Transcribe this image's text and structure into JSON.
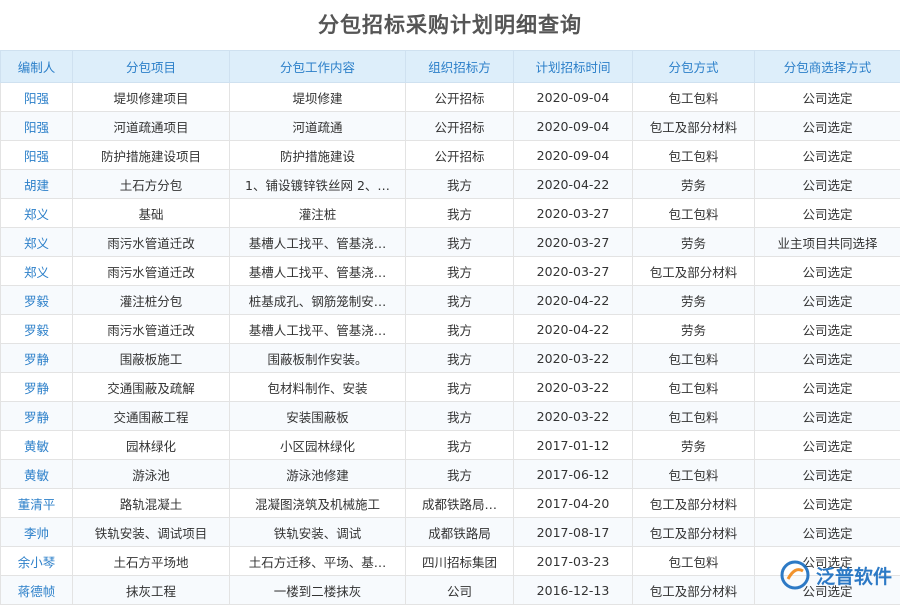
{
  "page": {
    "title": "分包招标采购计划明细查询"
  },
  "table": {
    "columns": [
      "编制人",
      "分包项目",
      "分包工作内容",
      "组织招标方",
      "计划招标时间",
      "分包方式",
      "分包商选择方式"
    ],
    "rows": [
      [
        "阳强",
        "堤坝修建项目",
        "堤坝修建",
        "公开招标",
        "2020-09-04",
        "包工包料",
        "公司选定"
      ],
      [
        "阳强",
        "河道疏通项目",
        "河道疏通",
        "公开招标",
        "2020-09-04",
        "包工及部分材料",
        "公司选定"
      ],
      [
        "阳强",
        "防护措施建设项目",
        "防护措施建设",
        "公开招标",
        "2020-09-04",
        "包工包料",
        "公司选定"
      ],
      [
        "胡建",
        "土石方分包",
        "1、铺设镀锌铁丝网 2、…",
        "我方",
        "2020-04-22",
        "劳务",
        "公司选定"
      ],
      [
        "郑义",
        "基础",
        "灌注桩",
        "我方",
        "2020-03-27",
        "包工包料",
        "公司选定"
      ],
      [
        "郑义",
        "雨污水管道迁改",
        "基槽人工找平、管基浇…",
        "我方",
        "2020-03-27",
        "劳务",
        "业主项目共同选择"
      ],
      [
        "郑义",
        "雨污水管道迁改",
        "基槽人工找平、管基浇…",
        "我方",
        "2020-03-27",
        "包工及部分材料",
        "公司选定"
      ],
      [
        "罗毅",
        "灌注桩分包",
        "桩基成孔、钢筋笼制安…",
        "我方",
        "2020-04-22",
        "劳务",
        "公司选定"
      ],
      [
        "罗毅",
        "雨污水管道迁改",
        "基槽人工找平、管基浇…",
        "我方",
        "2020-04-22",
        "劳务",
        "公司选定"
      ],
      [
        "罗静",
        "围蔽板施工",
        "围蔽板制作安装。",
        "我方",
        "2020-03-22",
        "包工包料",
        "公司选定"
      ],
      [
        "罗静",
        "交通围蔽及疏解",
        "包材料制作、安装",
        "我方",
        "2020-03-22",
        "包工包料",
        "公司选定"
      ],
      [
        "罗静",
        "交通围蔽工程",
        "安装围蔽板",
        "我方",
        "2020-03-22",
        "包工包料",
        "公司选定"
      ],
      [
        "黄敏",
        "园林绿化",
        "小区园林绿化",
        "我方",
        "2017-01-12",
        "劳务",
        "公司选定"
      ],
      [
        "黄敏",
        "游泳池",
        "游泳池修建",
        "我方",
        "2017-06-12",
        "包工包料",
        "公司选定"
      ],
      [
        "董清平",
        "路轨混凝土",
        "混凝图浇筑及机械施工",
        "成都铁路局…",
        "2017-04-20",
        "包工及部分材料",
        "公司选定"
      ],
      [
        "李帅",
        "铁轨安装、调试项目",
        "铁轨安装、调试",
        "成都铁路局",
        "2017-08-17",
        "包工及部分材料",
        "公司选定"
      ],
      [
        "余小琴",
        "土石方平场地",
        "土石方迁移、平场、基…",
        "四川招标集团",
        "2017-03-23",
        "包工包料",
        "公司选定"
      ],
      [
        "蒋德帧",
        "抹灰工程",
        "一楼到二楼抹灰",
        "公司",
        "2016-12-13",
        "包工及部分材料",
        "公司选定"
      ]
    ]
  },
  "brand": {
    "logo_text": "泛普软件",
    "accent": "#1c6fc1",
    "header_bg": "#ddeefa",
    "header_text": "#2b7fc9"
  }
}
